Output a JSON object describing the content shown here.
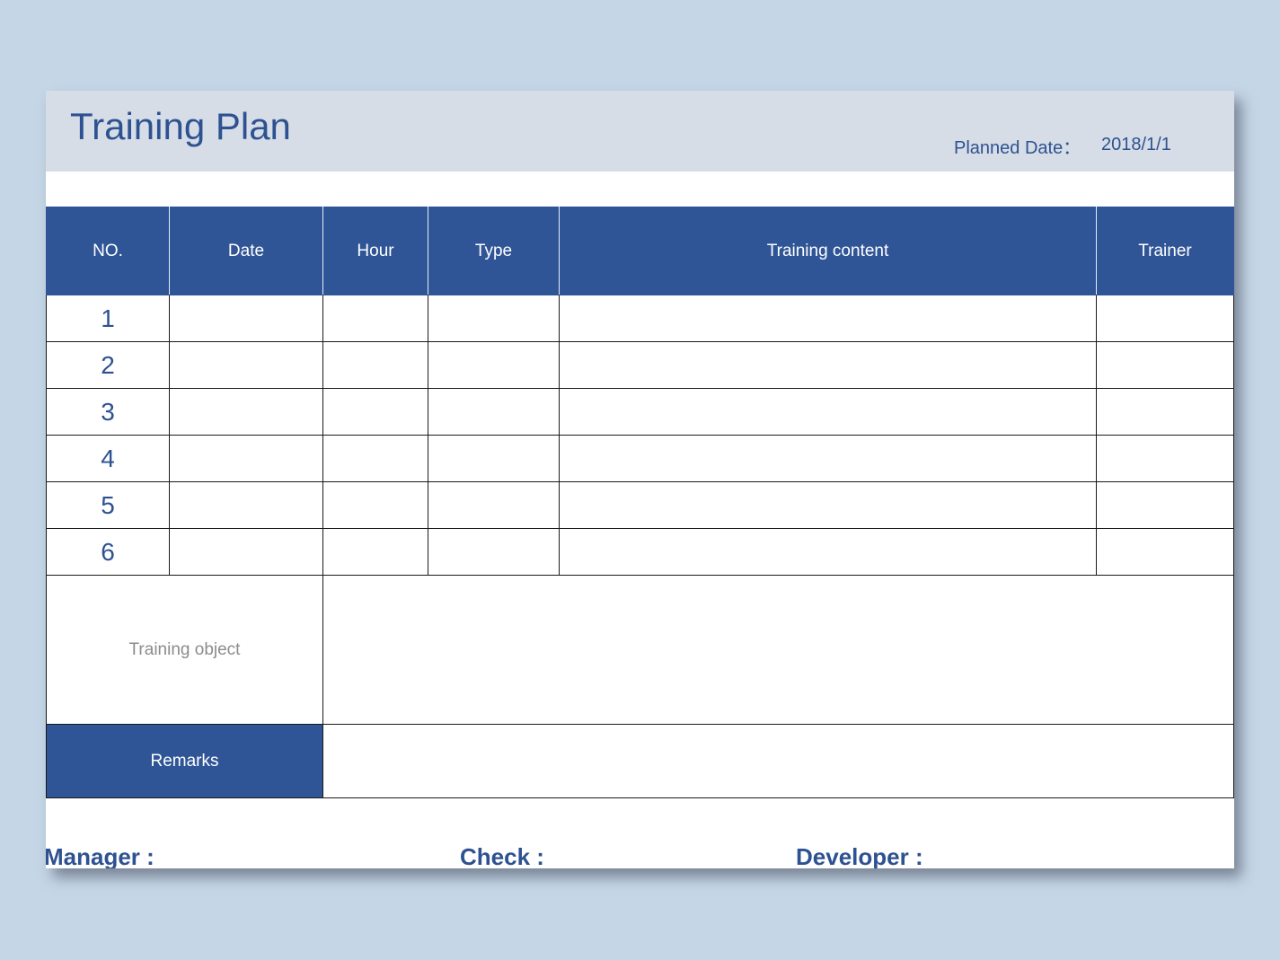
{
  "header": {
    "title": "Training Plan",
    "planned_date_label": "Planned Date：",
    "planned_date_value": "2018/1/1"
  },
  "table": {
    "columns": [
      "NO.",
      "Date",
      "Hour",
      "Type",
      "Training content",
      "Trainer"
    ],
    "rows": [
      {
        "no": "1",
        "date": "",
        "hour": "",
        "type": "",
        "content": "",
        "trainer": ""
      },
      {
        "no": "2",
        "date": "",
        "hour": "",
        "type": "",
        "content": "",
        "trainer": ""
      },
      {
        "no": "3",
        "date": "",
        "hour": "",
        "type": "",
        "content": "",
        "trainer": ""
      },
      {
        "no": "4",
        "date": "",
        "hour": "",
        "type": "",
        "content": "",
        "trainer": ""
      },
      {
        "no": "5",
        "date": "",
        "hour": "",
        "type": "",
        "content": "",
        "trainer": ""
      },
      {
        "no": "6",
        "date": "",
        "hour": "",
        "type": "",
        "content": "",
        "trainer": ""
      }
    ],
    "training_object_label": "Training object",
    "training_object_value": "",
    "remarks_label": "Remarks",
    "remarks_value": ""
  },
  "signatures": {
    "manager_label": "Manager :",
    "check_label": "Check :",
    "developer_label": "Developer :"
  },
  "colors": {
    "page_background": "#c5d6e6",
    "header_band": "#d6dde6",
    "table_header": "#2f5597",
    "text_blue": "#2e5291"
  }
}
